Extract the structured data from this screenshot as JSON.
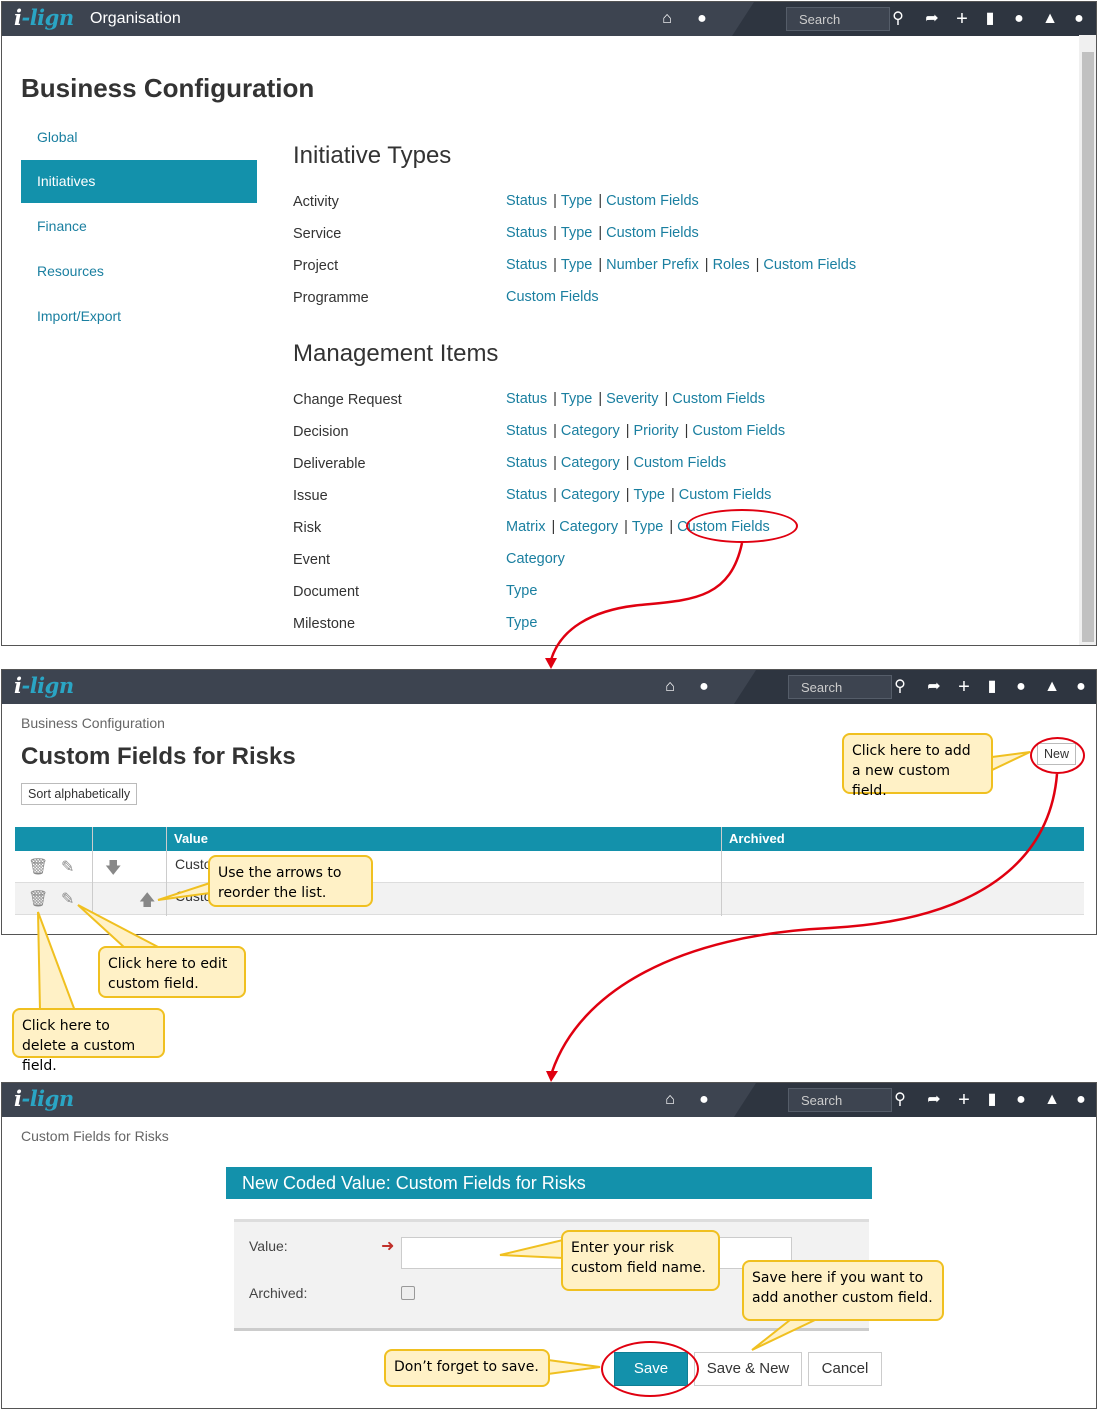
{
  "app": {
    "logo_i": "i",
    "logo_rest": "-lign"
  },
  "search": {
    "placeholder": "Search"
  },
  "screen1": {
    "app_title": "Organisation",
    "page_title": "Business Configuration",
    "nav": [
      "Global",
      "Initiatives",
      "Finance",
      "Resources",
      "Import/Export"
    ],
    "initiative_types_title": "Initiative Types",
    "initiative_types": [
      {
        "label": "Activity",
        "links": [
          "Status",
          "Type",
          "Custom Fields"
        ]
      },
      {
        "label": "Service",
        "links": [
          "Status",
          "Type",
          "Custom Fields"
        ]
      },
      {
        "label": "Project",
        "links": [
          "Status",
          "Type",
          "Number Prefix",
          "Roles",
          "Custom Fields"
        ]
      },
      {
        "label": "Programme",
        "links": [
          "Custom Fields"
        ]
      }
    ],
    "management_items_title": "Management Items",
    "management_items": [
      {
        "label": "Change Request",
        "links": [
          "Status",
          "Type",
          "Severity",
          "Custom Fields"
        ]
      },
      {
        "label": "Decision",
        "links": [
          "Status",
          "Category",
          "Priority",
          "Custom Fields"
        ]
      },
      {
        "label": "Deliverable",
        "links": [
          "Status",
          "Category",
          "Custom Fields"
        ]
      },
      {
        "label": "Issue",
        "links": [
          "Status",
          "Category",
          "Type",
          "Custom Fields"
        ]
      },
      {
        "label": "Risk",
        "links": [
          "Matrix",
          "Category",
          "Type",
          "Custom Fields"
        ]
      },
      {
        "label": "Event",
        "links": [
          "Category"
        ]
      },
      {
        "label": "Document",
        "links": [
          "Type"
        ]
      },
      {
        "label": "Milestone",
        "links": [
          "Type"
        ]
      }
    ]
  },
  "screen2": {
    "breadcrumb": "Business Configuration",
    "page_title": "Custom Fields for Risks",
    "sort_button": "Sort alphabetically",
    "new_button": "New",
    "columns": {
      "value": "Value",
      "archived": "Archived"
    },
    "rows": [
      {
        "value": "Custo"
      },
      {
        "value": "Custo"
      }
    ]
  },
  "screen3": {
    "breadcrumb": "Custom Fields for Risks",
    "dialog_title": "New Coded Value: Custom Fields for Risks",
    "value_label": "Value:",
    "value_input": "",
    "archived_label": "Archived:",
    "save": "Save",
    "save_new": "Save & New",
    "cancel": "Cancel"
  },
  "callouts": {
    "add_new": "Click here to add a new custom field.",
    "reorder": "Use the arrows to reorder the list.",
    "edit": "Click here to edit custom field.",
    "delete": "Click here to delete a custom field.",
    "enter_name": "Enter your risk custom field name.",
    "save_another": "Save here if you want to add another custom field.",
    "forget_save": "Don’t forget to save."
  },
  "colors": {
    "accent": "#1391ab",
    "header": "#3d4450",
    "link": "#1a7fa0",
    "annotation_red": "#e00010",
    "callout_fill": "#fff1c6",
    "callout_border": "#f0c020"
  },
  "icons": [
    "home-icon",
    "globe-icon",
    "search-icon",
    "share-icon",
    "plus-icon",
    "bookmark-icon",
    "chat-icon",
    "bell-icon",
    "user-icon",
    "trash-icon",
    "pencil-icon",
    "arrow-down-icon",
    "arrow-up-icon",
    "required-arrow-icon"
  ]
}
